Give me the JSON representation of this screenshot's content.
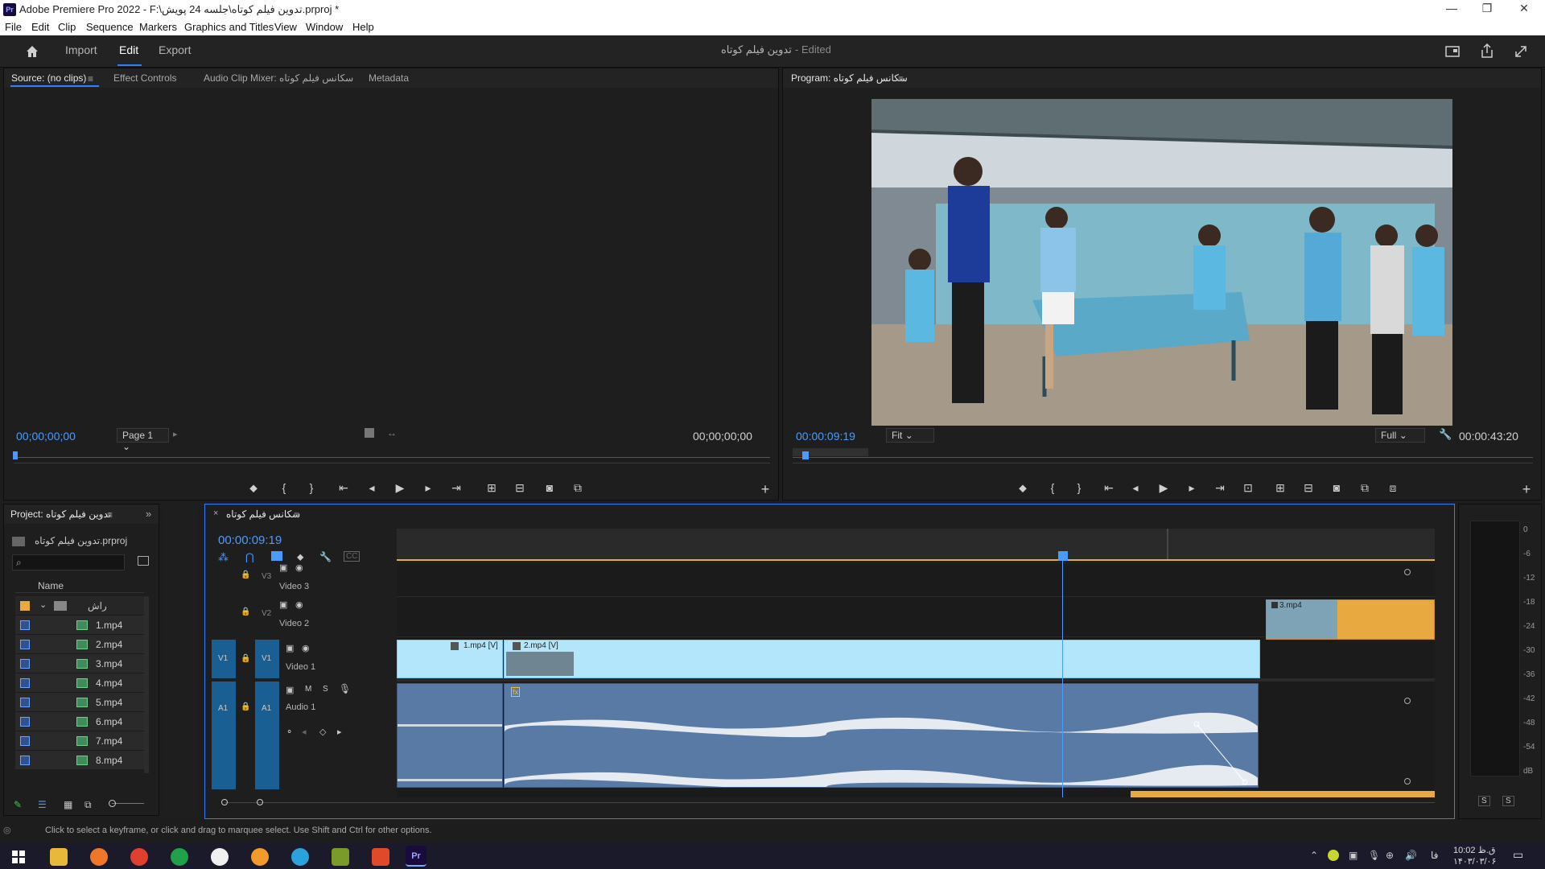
{
  "title_bar": {
    "app_title": "Adobe Premiere Pro 2022 - F:\\تدوین فیلم کوتاه\\جلسه 24 پویش.prproj *",
    "icon": "Pr"
  },
  "window_controls": {
    "minimize": "—",
    "restore": "❐",
    "close": "✕"
  },
  "menu": [
    "File",
    "Edit",
    "Clip",
    "Sequence",
    "Markers",
    "Graphics and Titles",
    "View",
    "Window",
    "Help"
  ],
  "workspace": {
    "tabs": [
      "Import",
      "Edit",
      "Export"
    ],
    "active": "Edit",
    "project_title": "تدوین فیلم کوتاه",
    "status": "- Edited"
  },
  "source_panel": {
    "tabs": [
      "Source: (no clips)",
      "Effect Controls",
      "Audio Clip Mixer: سکانس فیلم کوتاه",
      "Metadata"
    ],
    "timecode_left": "00;00;00;00",
    "page": "Page 1",
    "timecode_right": "00;00;00;00"
  },
  "program_panel": {
    "title": "Program: سکانس فیلم کوتاه",
    "timecode": "00:00:09:19",
    "fit": "Fit",
    "resolution": "Full",
    "duration": "00:00:43:20"
  },
  "project_panel": {
    "title": "Project: تدوین فیلم کوتاه",
    "file": "تدوین فیلم کوتاه.prproj",
    "column": "Name",
    "folder": "راش",
    "items": [
      "1.mp4",
      "2.mp4",
      "3.mp4",
      "4.mp4",
      "5.mp4",
      "6.mp4",
      "7.mp4",
      "8.mp4"
    ]
  },
  "timeline": {
    "sequence": "سکانس فیلم کوتاه",
    "timecode": "00:00:09:19",
    "tracks": [
      {
        "id": "V3",
        "name": "Video 3"
      },
      {
        "id": "V2",
        "name": "Video 2"
      },
      {
        "id": "V1",
        "name": "Video 1"
      },
      {
        "id": "A1",
        "name": "Audio 1"
      }
    ],
    "source_v1": "V1",
    "source_a1": "A1",
    "clips": {
      "clip1": "1.mp4 [V]",
      "clip2": "2.mp4 [V]",
      "clip3": "3.mp4"
    },
    "fx": "fx",
    "track_buttons": {
      "mute": "M",
      "solo": "S"
    }
  },
  "meters": {
    "labels": [
      "0",
      "-6",
      "-12",
      "-18",
      "-24",
      "-30",
      "-36",
      "-42",
      "-48",
      "-54",
      "dB"
    ],
    "solo_left": "S",
    "solo_right": "S"
  },
  "status_bar": {
    "hint": "Click to select a keyframe, or click and drag to marquee select. Use Shift and Ctrl for other options."
  },
  "taskbar": {
    "time": "10:02 ق.ظ",
    "date": "۱۴۰۳/۰۳/۰۶",
    "lang": "فا"
  },
  "colors": {
    "accent": "#2e7fff",
    "timecode": "#4a9bff",
    "video_clip": "#b3e6fb",
    "audio_clip": "#5a7aa6",
    "clip_orange": "#e8a940",
    "track_target": "#1a5f94"
  }
}
